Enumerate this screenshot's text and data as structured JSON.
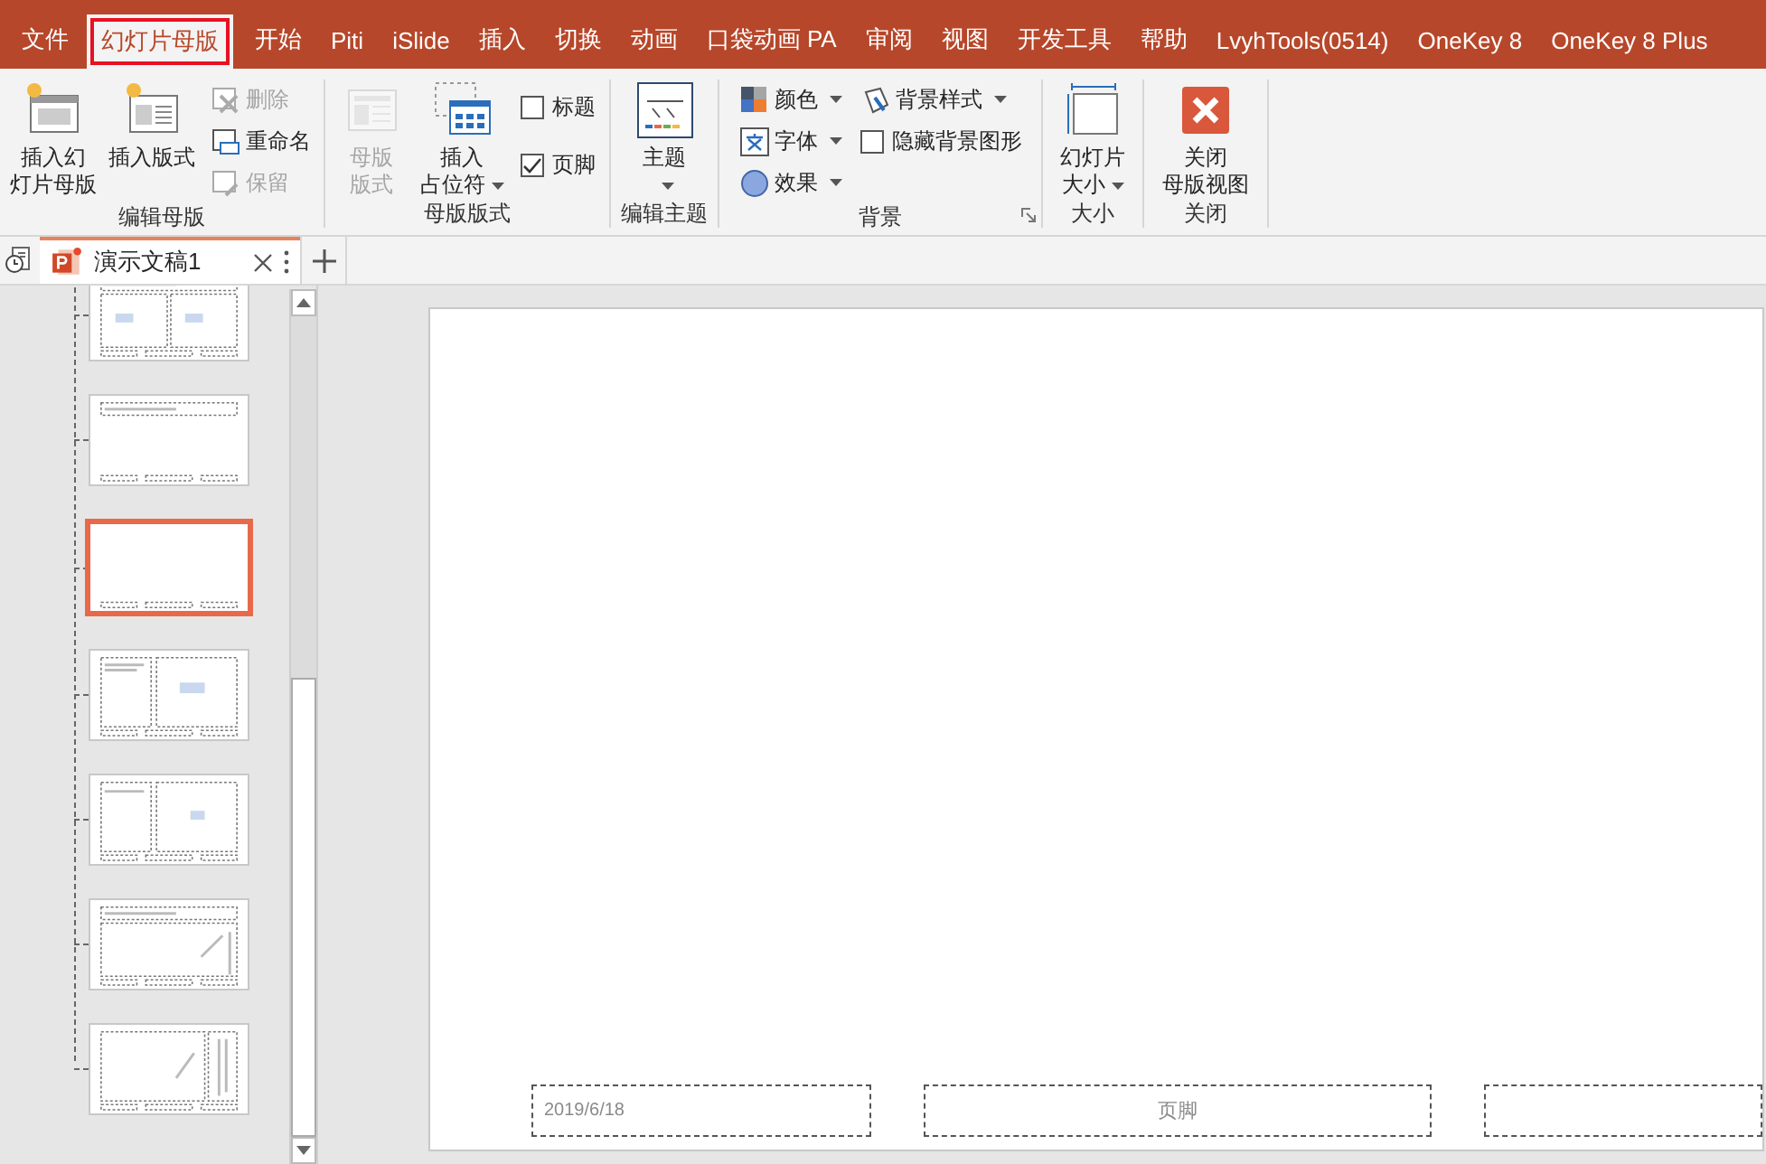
{
  "menu_tabs": [
    {
      "label": "文件",
      "selected": false
    },
    {
      "label": "幻灯片母版",
      "selected": true
    },
    {
      "label": "开始",
      "selected": false
    },
    {
      "label": "Piti",
      "selected": false
    },
    {
      "label": "iSlide",
      "selected": false
    },
    {
      "label": "插入",
      "selected": false
    },
    {
      "label": "切换",
      "selected": false
    },
    {
      "label": "动画",
      "selected": false
    },
    {
      "label": "口袋动画 PA",
      "selected": false
    },
    {
      "label": "审阅",
      "selected": false
    },
    {
      "label": "视图",
      "selected": false
    },
    {
      "label": "开发工具",
      "selected": false
    },
    {
      "label": "帮助",
      "selected": false
    },
    {
      "label": "LvyhTools(0514)",
      "selected": false
    },
    {
      "label": "OneKey 8",
      "selected": false
    },
    {
      "label": "OneKey 8 Plus",
      "selected": false
    }
  ],
  "ribbon_groups": [
    {
      "label": "编辑母版",
      "launcher": false,
      "items": [
        {
          "kind": "large",
          "lines": [
            "插入幻",
            "灯片母版"
          ],
          "disabled": false,
          "dropdown": false
        },
        {
          "kind": "large",
          "lines": [
            "插入版式"
          ],
          "disabled": false,
          "dropdown": false
        },
        {
          "kind": "stack",
          "items": [
            {
              "kind": "small",
              "label": "删除",
              "disabled": true,
              "dropdown": false
            },
            {
              "kind": "small",
              "label": "重命名",
              "disabled": false,
              "dropdown": false
            },
            {
              "kind": "small",
              "label": "保留",
              "disabled": true,
              "dropdown": false
            }
          ]
        }
      ]
    },
    {
      "label": "母版版式",
      "launcher": false,
      "items": [
        {
          "kind": "large",
          "lines": [
            "母版",
            "版式"
          ],
          "disabled": true,
          "dropdown": false
        },
        {
          "kind": "large",
          "lines": [
            "插入",
            "占位符"
          ],
          "disabled": false,
          "dropdown": true
        },
        {
          "kind": "stack",
          "items": [
            {
              "kind": "checkbox",
              "label": "标题",
              "checked": false
            },
            {
              "kind": "checkbox",
              "label": "页脚",
              "checked": true
            }
          ]
        }
      ]
    },
    {
      "label": "编辑主题",
      "launcher": false,
      "items": [
        {
          "kind": "large",
          "lines": [
            "主题"
          ],
          "disabled": false,
          "dropdown": true
        }
      ]
    },
    {
      "label": "背景",
      "launcher": true,
      "items": [
        {
          "kind": "stack",
          "items": [
            {
              "kind": "small",
              "label": "颜色",
              "disabled": false,
              "dropdown": true
            },
            {
              "kind": "small",
              "label": "字体",
              "disabled": false,
              "dropdown": true
            },
            {
              "kind": "small",
              "label": "效果",
              "disabled": false,
              "dropdown": true
            }
          ]
        },
        {
          "kind": "stack",
          "items": [
            {
              "kind": "small",
              "label": "背景样式",
              "disabled": false,
              "dropdown": true
            },
            {
              "kind": "checkbox",
              "label": "隐藏背景图形",
              "checked": false
            }
          ]
        }
      ]
    },
    {
      "label": "大小",
      "launcher": false,
      "items": [
        {
          "kind": "large",
          "lines": [
            "幻灯片",
            "大小"
          ],
          "disabled": false,
          "dropdown": true
        }
      ]
    },
    {
      "label": "关闭",
      "launcher": false,
      "items": [
        {
          "kind": "large",
          "lines": [
            "关闭",
            "母版视图"
          ],
          "disabled": false,
          "dropdown": false
        }
      ]
    }
  ],
  "document_tab": {
    "title": "演示文稿1"
  },
  "thumbnails": [
    {
      "kind": "two-content",
      "selected": false
    },
    {
      "kind": "title-only",
      "selected": false
    },
    {
      "kind": "blank",
      "selected": true
    },
    {
      "kind": "content-caption",
      "selected": false
    },
    {
      "kind": "picture-caption",
      "selected": false
    },
    {
      "kind": "vertical-text",
      "selected": false
    },
    {
      "kind": "vertical-title",
      "selected": false
    }
  ],
  "slide": {
    "footer_placeholders": [
      {
        "kind": "date",
        "text": "2019/6/18"
      },
      {
        "kind": "footer",
        "text": "页脚"
      },
      {
        "kind": "blank"
      }
    ]
  }
}
